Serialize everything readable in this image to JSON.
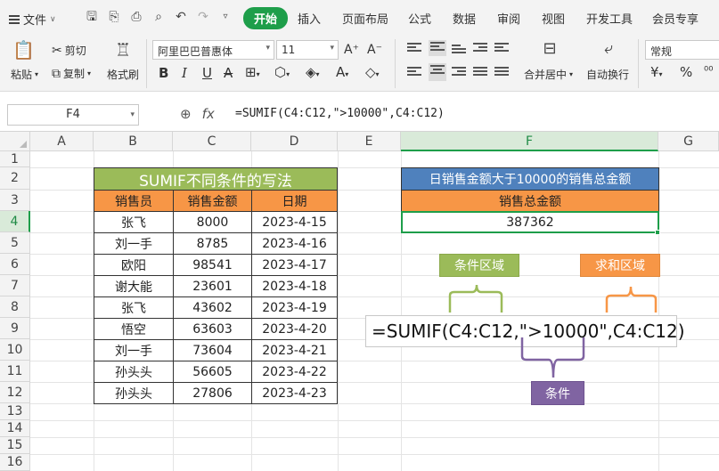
{
  "menu": {
    "file_label": "文件",
    "tabs": [
      "开始",
      "插入",
      "页面布局",
      "公式",
      "数据",
      "审阅",
      "视图",
      "开发工具",
      "会员专享"
    ],
    "active_tab": "开始"
  },
  "ribbon": {
    "paste_label": "粘贴",
    "cut_label": "剪切",
    "copy_label": "复制",
    "format_painter_label": "格式刷",
    "font_name": "阿里巴巴普惠体",
    "font_size": "11",
    "merge_label": "合并居中",
    "wrap_label": "自动换行",
    "number_format": "常规",
    "currency_symbol": "¥",
    "percent_symbol": "%"
  },
  "formula_bar": {
    "name_box": "F4",
    "fx": "fx",
    "formula": "=SUMIF(C4:C12,\">10000\",C4:C12)"
  },
  "columns": [
    "A",
    "B",
    "C",
    "D",
    "E",
    "F",
    "G"
  ],
  "selected_column": "F",
  "rows": [
    "1",
    "2",
    "3",
    "4",
    "5",
    "6",
    "7",
    "8",
    "9",
    "10",
    "11",
    "12",
    "13",
    "14",
    "15",
    "16"
  ],
  "selected_row": "4",
  "table": {
    "title": "SUMIF不同条件的写法",
    "headers": [
      "销售员",
      "销售金额",
      "日期"
    ],
    "rows": [
      [
        "张飞",
        "8000",
        "2023-4-15"
      ],
      [
        "刘一手",
        "8785",
        "2023-4-16"
      ],
      [
        "欧阳",
        "98541",
        "2023-4-17"
      ],
      [
        "谢大能",
        "23601",
        "2023-4-18"
      ],
      [
        "张飞",
        "43602",
        "2023-4-19"
      ],
      [
        "悟空",
        "63603",
        "2023-4-20"
      ],
      [
        "刘一手",
        "73604",
        "2023-4-21"
      ],
      [
        "孙头头",
        "56605",
        "2023-4-22"
      ],
      [
        "孙头头",
        "27806",
        "2023-4-23"
      ]
    ]
  },
  "result": {
    "title": "日销售金额大于10000的销售总金额",
    "header": "销售总金额",
    "value": "387362"
  },
  "annotations": {
    "formula": "=SUMIF(C4:C12,\">10000\",C4:C12)",
    "range_label": "条件区域",
    "sum_label": "求和区域",
    "criteria_label": "条件"
  },
  "colors": {
    "accent_green": "#1e9e4a",
    "title_green": "#9bbb59",
    "header_orange": "#f79646",
    "header_blue": "#4f81bd",
    "criteria_purple": "#8064a2"
  }
}
